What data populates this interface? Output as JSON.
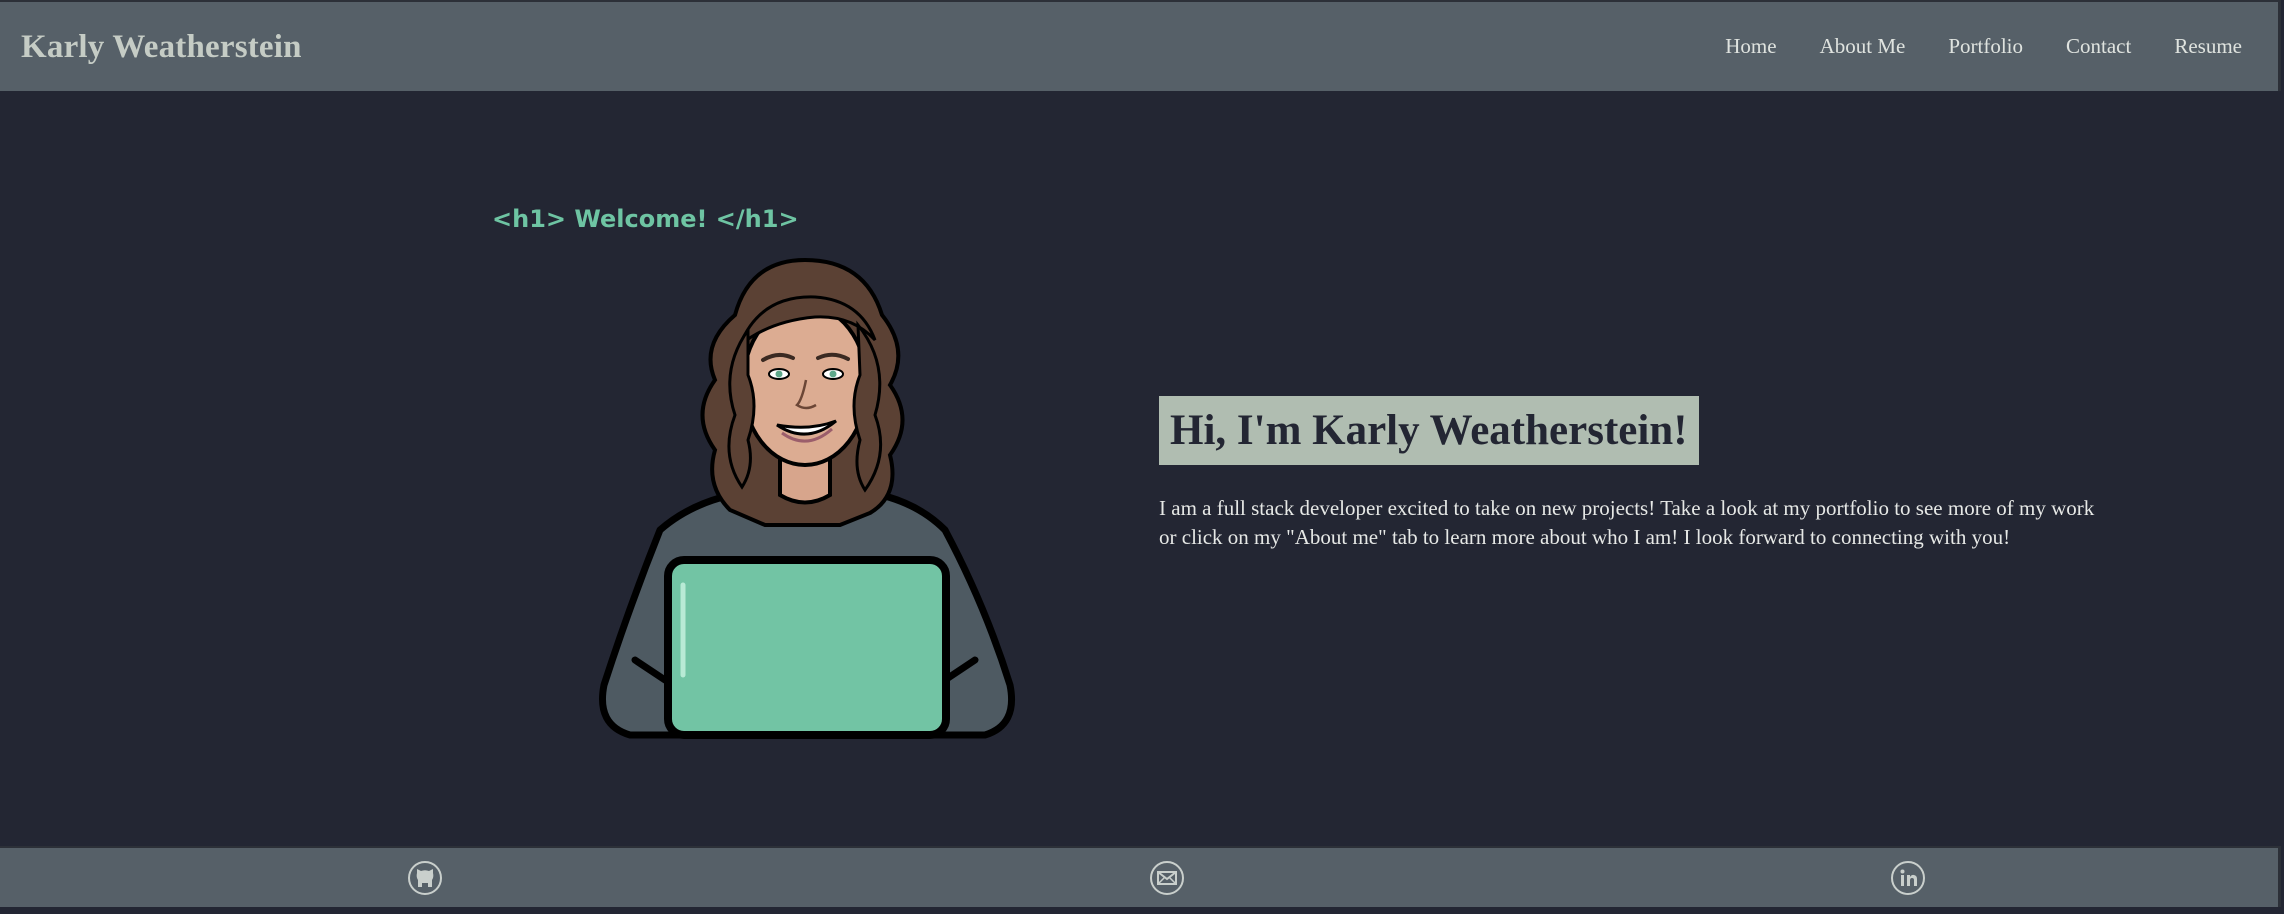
{
  "header": {
    "brand": "Karly Weatherstein",
    "nav": [
      "Home",
      "About Me",
      "Portfolio",
      "Contact",
      "Resume"
    ]
  },
  "hero": {
    "code_label": "<h1> Welcome! </h1>",
    "title": "Hi, I'm Karly Weatherstein!",
    "description": "I am a full stack developer excited to take on new projects! Take a look at my portfolio to see more of my work or click on my \"About me\" tab to learn more about who I am! I look forward to connecting with you!"
  },
  "footer": {
    "icons": [
      "github-icon",
      "email-icon",
      "linkedin-icon"
    ]
  },
  "colors": {
    "background": "#232633",
    "header": "#566068",
    "accent": "#6ec4a3",
    "title_bg": "#b0bdb1"
  }
}
